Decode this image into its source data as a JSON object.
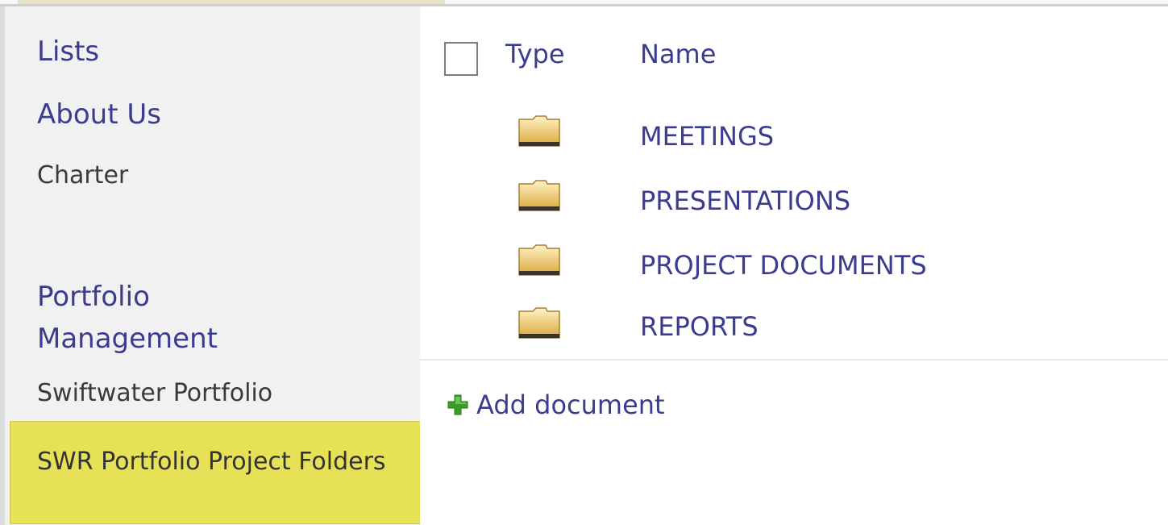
{
  "nav": {
    "items": [
      {
        "label": "Lists"
      },
      {
        "label": "About Us"
      },
      {
        "label": "Charter"
      },
      {
        "label": "Portfolio Management"
      },
      {
        "label": "Swiftwater Portfolio"
      },
      {
        "label": "SWR Portfolio Project Folders"
      }
    ],
    "selected_index": 5,
    "selected_highlight_color": "#e6e157"
  },
  "library": {
    "columns": {
      "type": "Type",
      "name": "Name"
    },
    "rows": [
      {
        "icon": "folder-icon",
        "name": "MEETINGS"
      },
      {
        "icon": "folder-icon",
        "name": "PRESENTATIONS"
      },
      {
        "icon": "folder-icon",
        "name": "PROJECT DOCUMENTS"
      },
      {
        "icon": "folder-icon",
        "name": "REPORTS"
      }
    ],
    "add_action": {
      "icon": "plus-icon",
      "label": "Add document"
    }
  },
  "colors": {
    "link": "#3b3b8f",
    "nav_background": "#f1f1f1",
    "add_icon_green": "#3a9d23"
  }
}
